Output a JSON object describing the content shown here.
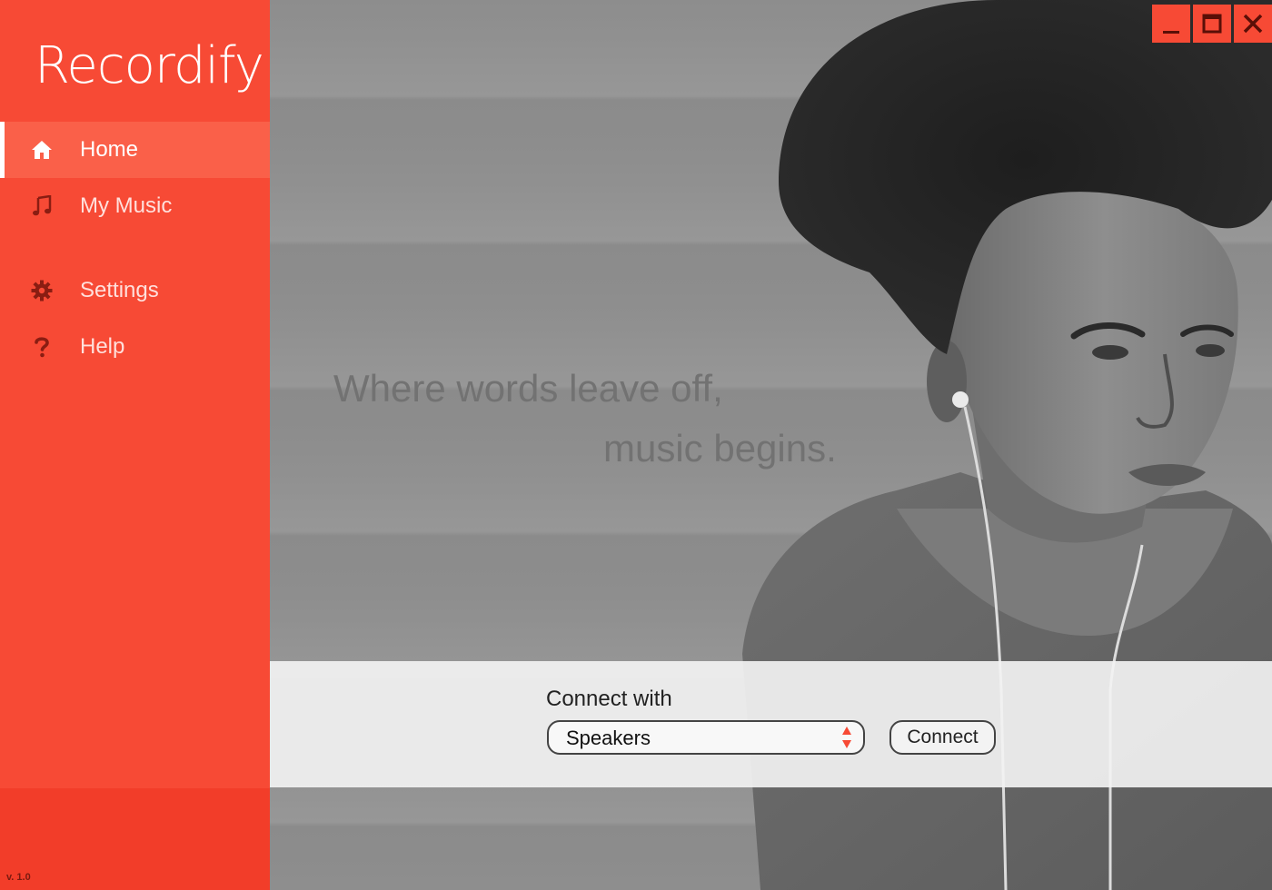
{
  "app": {
    "name": "Recordify",
    "version": "v. 1.0",
    "accent_color": "#f74a35"
  },
  "sidebar": {
    "items": [
      {
        "label": "Home",
        "icon": "home-icon",
        "active": true
      },
      {
        "label": "My Music",
        "icon": "music-note-icon",
        "active": false
      },
      {
        "label": "Settings",
        "icon": "gear-icon",
        "active": false
      },
      {
        "label": "Help",
        "icon": "question-icon",
        "active": false
      }
    ]
  },
  "hero": {
    "tagline_line1": "Where words leave off,",
    "tagline_line2": "music begins."
  },
  "window_controls": [
    "minimize-icon",
    "maximize-icon",
    "close-icon"
  ],
  "connect": {
    "label": "Connect with",
    "selected_device": "Speakers",
    "button_label": "Connect"
  }
}
